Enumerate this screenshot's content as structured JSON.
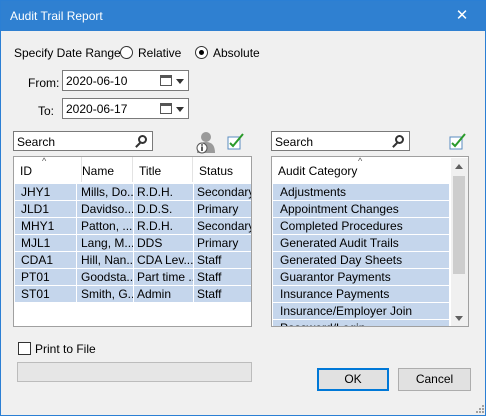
{
  "window": {
    "title": "Audit Trail Report",
    "close_glyph": "✕"
  },
  "date_range": {
    "label": "Specify Date Range",
    "options": [
      {
        "label": "Relative",
        "checked": false
      },
      {
        "label": "Absolute",
        "checked": true
      }
    ],
    "from_label": "From:",
    "from_value": "2020-06-10",
    "to_label": "To:",
    "to_value": "2020-06-17"
  },
  "users_panel": {
    "search_placeholder": "Search",
    "columns": [
      "ID",
      "Name",
      "Title",
      "Status"
    ],
    "rows": [
      [
        "JHY1",
        "Mills, Do...",
        "R.D.H.",
        "Secondary"
      ],
      [
        "JLD1",
        "Davidso...",
        "D.D.S.",
        "Primary"
      ],
      [
        "MHY1",
        "Patton, ...",
        "R.D.H.",
        "Secondary"
      ],
      [
        "MJL1",
        "Lang, M...",
        "DDS",
        "Primary"
      ],
      [
        "CDA1",
        "Hill, Nan...",
        "CDA Lev...",
        "Staff"
      ],
      [
        "PT01",
        "Goodsta...",
        "Part time ...",
        "Staff"
      ],
      [
        "ST01",
        "Smith, G...",
        "Admin",
        "Staff"
      ]
    ]
  },
  "categories_panel": {
    "search_placeholder": "Search",
    "column": "Audit Category",
    "items": [
      "Adjustments",
      "Appointment Changes",
      "Completed Procedures",
      "Generated Audit Trails",
      "Generated Day Sheets",
      "Guarantor Payments",
      "Insurance Payments",
      "Insurance/Employer Join",
      "Password/Login"
    ]
  },
  "print_to_file": {
    "label": "Print to File",
    "checked": false
  },
  "buttons": {
    "ok": "OK",
    "cancel": "Cancel"
  },
  "colors": {
    "titlebar": "#2f80d1",
    "selection": "#c5d6ec",
    "accent": "#0078d7"
  }
}
